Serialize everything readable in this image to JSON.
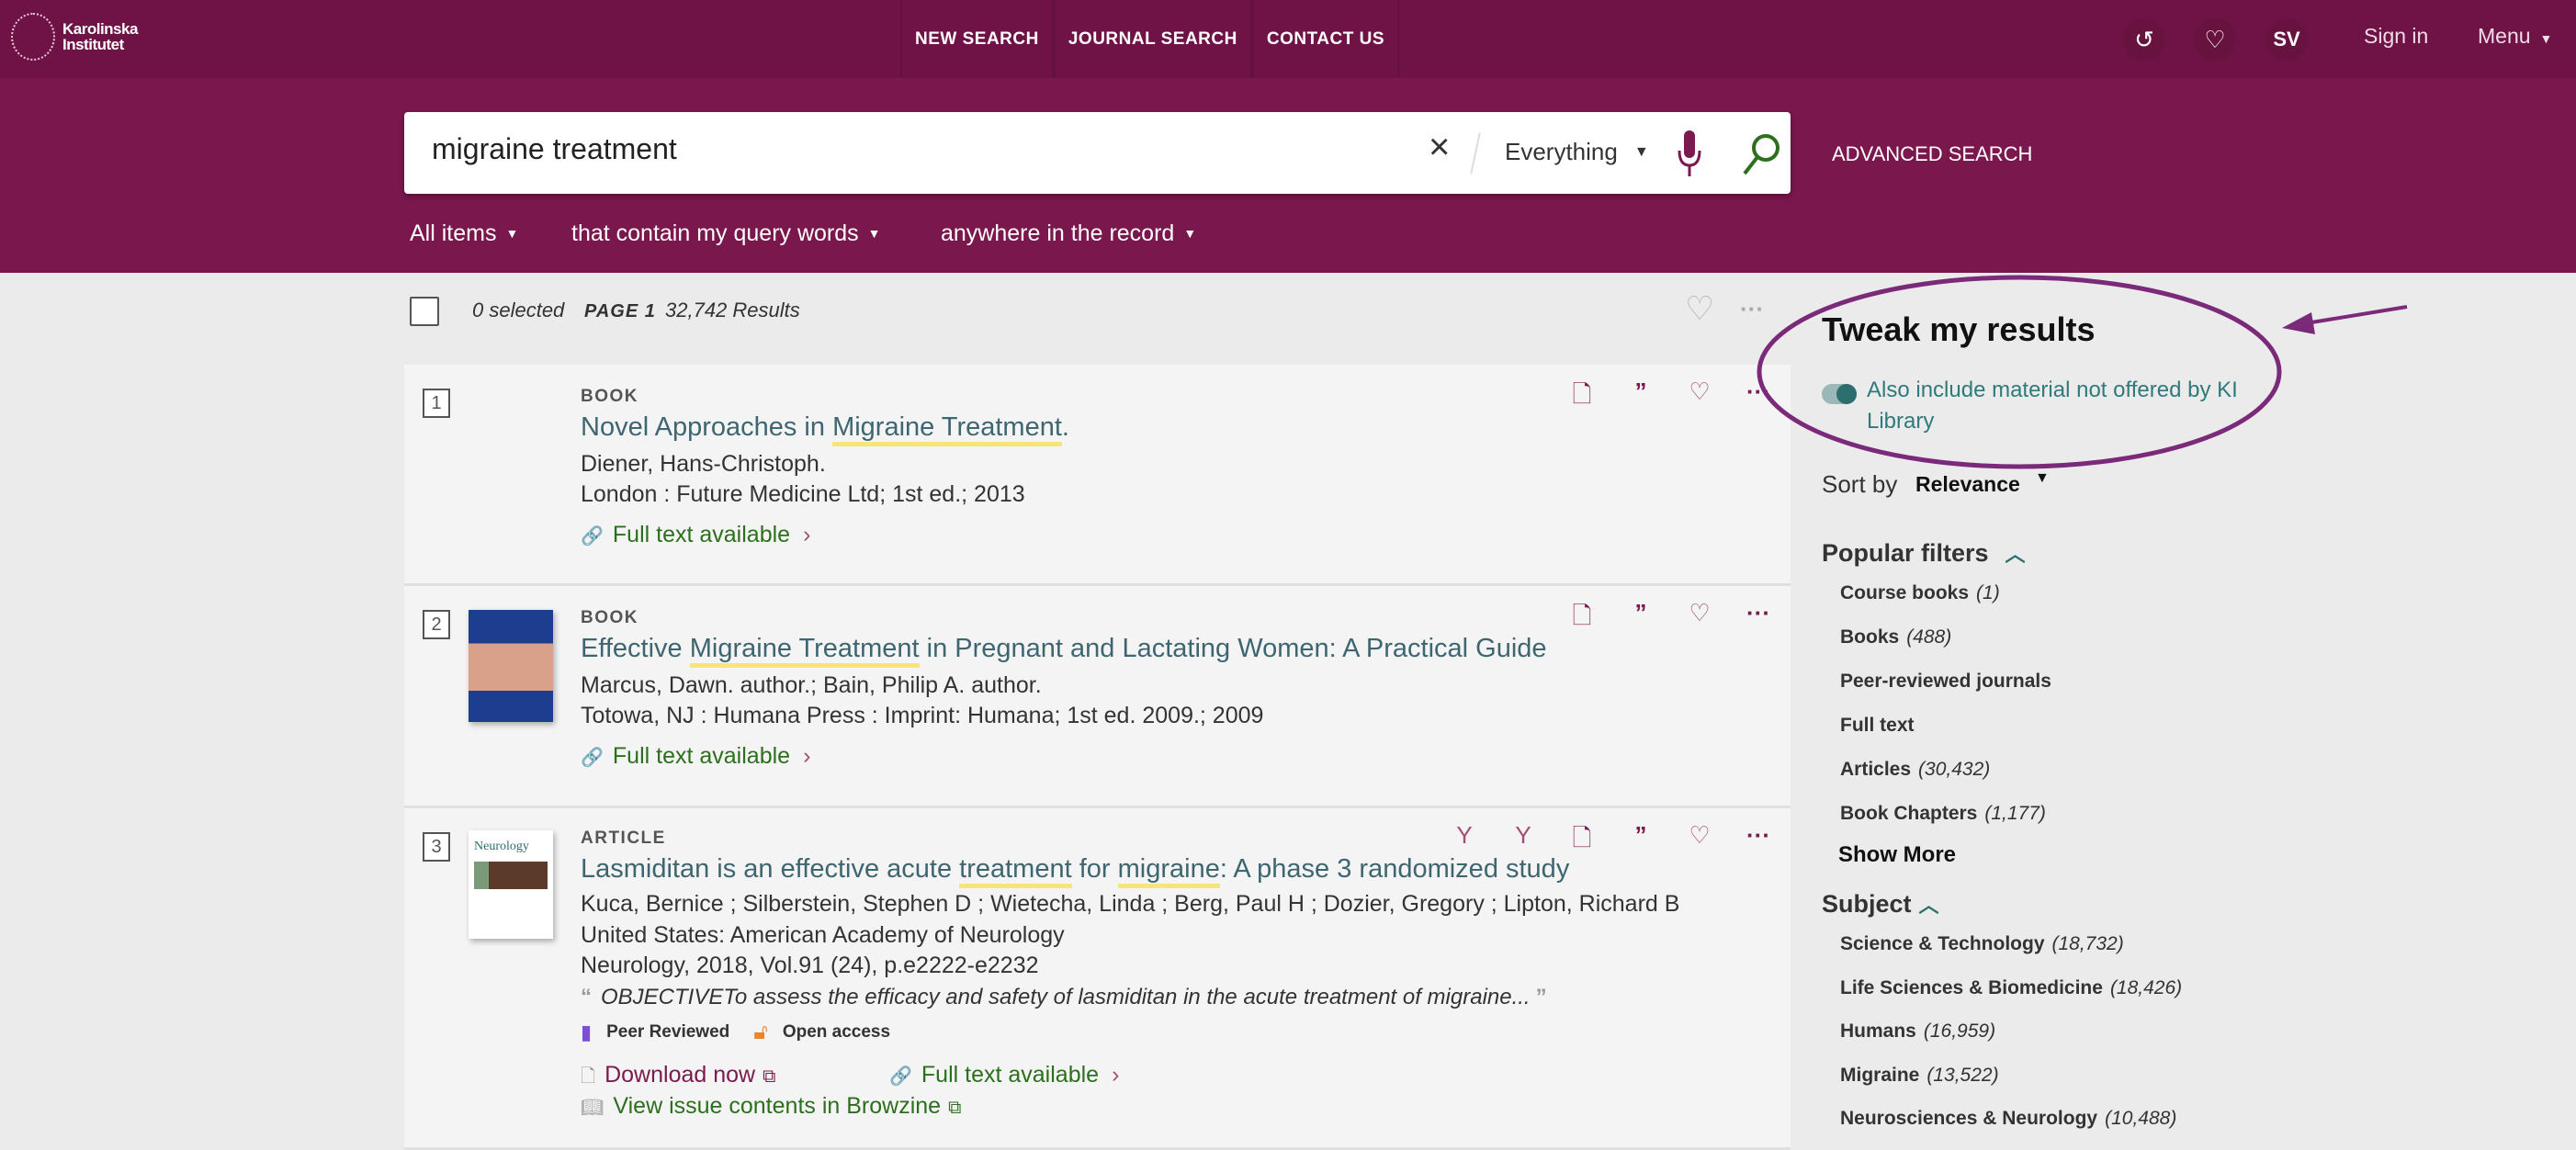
{
  "header": {
    "logo_text": [
      "Karolinska",
      "Institutet"
    ],
    "nav": [
      "NEW SEARCH",
      "JOURNAL SEARCH",
      "CONTACT US"
    ],
    "lang": "SV",
    "sign_in": "Sign in",
    "menu": "Menu",
    "icons": [
      "history-icon",
      "heart-icon"
    ]
  },
  "search": {
    "query": "migraine treatment",
    "scope": "Everything",
    "advanced": "ADVANCED SEARCH",
    "filters": [
      "All items",
      "that contain my query words",
      "anywhere in the record"
    ]
  },
  "toolbar": {
    "selected": "0 selected",
    "page": "PAGE 1",
    "results": "32,742 Results"
  },
  "results": [
    {
      "num": "1",
      "type": "BOOK",
      "title_pre": "Novel Approaches in ",
      "title_hl": "Migraine Treatment",
      "title_post": ".",
      "authors": "Diener, Hans-Christoph.",
      "pub": "London : Future Medicine Ltd; 1st ed.; 2013",
      "fulltext": "Full text available"
    },
    {
      "num": "2",
      "type": "BOOK",
      "title_pre": "Effective ",
      "title_hl": "Migraine Treatment",
      "title_post": " in Pregnant and Lactating Women: A Practical Guide",
      "authors": "Marcus, Dawn. author.; Bain, Philip A. author.",
      "pub": "Totowa, NJ : Humana Press : Imprint: Humana; 1st ed. 2009.; 2009",
      "fulltext": "Full text available"
    },
    {
      "num": "3",
      "type": "ARTICLE",
      "title_a": "Lasmiditan is an effective acute ",
      "title_hl1": "treatment",
      "title_b": " for ",
      "title_hl2": "migraine",
      "title_c": ": A phase 3 randomized study",
      "authors": "Kuca, Bernice ; Silberstein, Stephen D ; Wietecha, Linda ; Berg, Paul H ; Dozier, Gregory ; Lipton, Richard B",
      "publisher": "United States: American Academy of Neurology",
      "source": "Neurology, 2018, Vol.91 (24), p.e2222-e2232",
      "abstract": "OBJECTIVETo assess the efficacy and safety of lasmiditan in the acute treatment of migraine...",
      "peer": "Peer Reviewed",
      "oa": "Open access",
      "download": "Download now",
      "fulltext": "Full text available",
      "browzine": "View issue contents in Browzine",
      "cover_text": "Neurology"
    }
  ],
  "sidebar": {
    "title": "Tweak my results",
    "toggle_label": "Also include material not offered by KI Library",
    "toggle_on": true,
    "sort_label": "Sort by",
    "sort_value": "Relevance",
    "popular_title": "Popular filters",
    "popular": [
      {
        "label": "Course books",
        "count": "(1)"
      },
      {
        "label": "Books",
        "count": "(488)"
      },
      {
        "label": "Peer-reviewed journals",
        "count": ""
      },
      {
        "label": "Full text",
        "count": ""
      },
      {
        "label": "Articles",
        "count": "(30,432)"
      },
      {
        "label": "Book Chapters",
        "count": "(1,177)"
      }
    ],
    "show_more": "Show More",
    "subject_title": "Subject",
    "subjects": [
      {
        "label": "Science & Technology",
        "count": "(18,732)"
      },
      {
        "label": "Life Sciences & Biomedicine",
        "count": "(18,426)"
      },
      {
        "label": "Humans",
        "count": "(16,959)"
      },
      {
        "label": "Migraine",
        "count": "(13,522)"
      },
      {
        "label": "Neurosciences & Neurology",
        "count": "(10,488)"
      }
    ]
  },
  "colors": {
    "header": "#6f1347",
    "band": "#7a174d",
    "accent": "#7b1a4e",
    "link_green": "#2c6f1c",
    "title_teal": "#3e6671",
    "annotation": "#7b2a7a"
  }
}
